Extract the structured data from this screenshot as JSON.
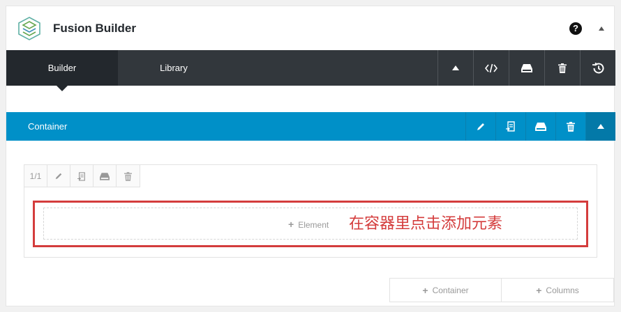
{
  "header": {
    "title": "Fusion Builder",
    "help_symbol": "?"
  },
  "tabs": {
    "builder": "Builder",
    "library": "Library"
  },
  "toolbar_icons": [
    "collapse-arrow-icon",
    "code-icon",
    "save-icon",
    "trash-icon",
    "history-icon"
  ],
  "container": {
    "label": "Container"
  },
  "container_icons": [
    "edit-pencil-icon",
    "clone-icon",
    "save-icon",
    "trash-icon",
    "collapse-arrow-icon"
  ],
  "column": {
    "size": "1/1",
    "add_element_label": "Element",
    "note": "在容器里点击添加元素"
  },
  "bottom": {
    "add_container": "Container",
    "add_columns": "Columns"
  },
  "plus_symbol": "+",
  "colors": {
    "toolbar": "#32373c",
    "active_tab": "#23282d",
    "container_bar": "#0090c8",
    "highlight": "#d43c3c"
  }
}
